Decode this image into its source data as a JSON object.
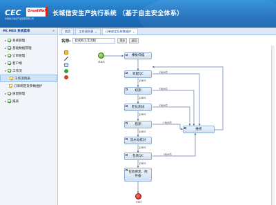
{
  "header": {
    "logo_text": "CEC",
    "logo_sub": "中国电子信息产业集团有限公司",
    "partner_logo": "GreatWall",
    "title": "长城信安生产执行系统 （基于自主安全体系）"
  },
  "sidebar": {
    "title": "PK MES 系统菜单",
    "collapse": "«",
    "items": [
      {
        "label": "系统管理",
        "expanded": false
      },
      {
        "label": "基础数据管理",
        "expanded": false
      },
      {
        "label": "订单管理",
        "expanded": false
      },
      {
        "label": "客户端",
        "expanded": false
      },
      {
        "label": "工作流",
        "expanded": true
      },
      {
        "label": "工作流列表",
        "child": true,
        "selected": true
      },
      {
        "label": "订单绑定及参数维护",
        "child": true
      },
      {
        "label": "质量管理",
        "expanded": false
      },
      {
        "label": "报表",
        "expanded": false
      }
    ]
  },
  "tabs": [
    {
      "label": "首页",
      "closable": false
    },
    {
      "label": "工作流列表",
      "closable": true
    },
    {
      "label": "订单绑定及参数维护",
      "closable": true,
      "active": true
    }
  ],
  "form": {
    "name_label": "名称:",
    "name_value": "拉式机工艺流程",
    "save_label": "保存",
    "back_label": "返回"
  },
  "palette": [
    {
      "icon": "select-pointer-icon",
      "color": "#f2c12e"
    },
    {
      "icon": "transition-line-icon",
      "color": "#3a3a3a"
    },
    {
      "icon": "task-node-icon",
      "color": "#7ba7d8"
    },
    {
      "icon": "start-node-icon",
      "color": "#3aa02d"
    },
    {
      "icon": "end-node-icon",
      "color": "#d83a26"
    }
  ],
  "flow": {
    "start_label": "start",
    "end_label": "end",
    "nodes": [
      {
        "id": "scan",
        "label": "裸板扫描"
      },
      {
        "id": "smt",
        "label": "装配QC"
      },
      {
        "id": "burnin",
        "label": "初测"
      },
      {
        "id": "aging",
        "label": "老化测试"
      },
      {
        "id": "final",
        "label": "后测"
      },
      {
        "id": "consistency",
        "label": "流水号校对"
      },
      {
        "id": "packqc",
        "label": "包装QC"
      },
      {
        "id": "bind",
        "label": "包装绑定、附件备"
      },
      {
        "id": "repair",
        "label": "维修"
      }
    ],
    "edge_pass": "pass",
    "edge_reject": "reject"
  }
}
